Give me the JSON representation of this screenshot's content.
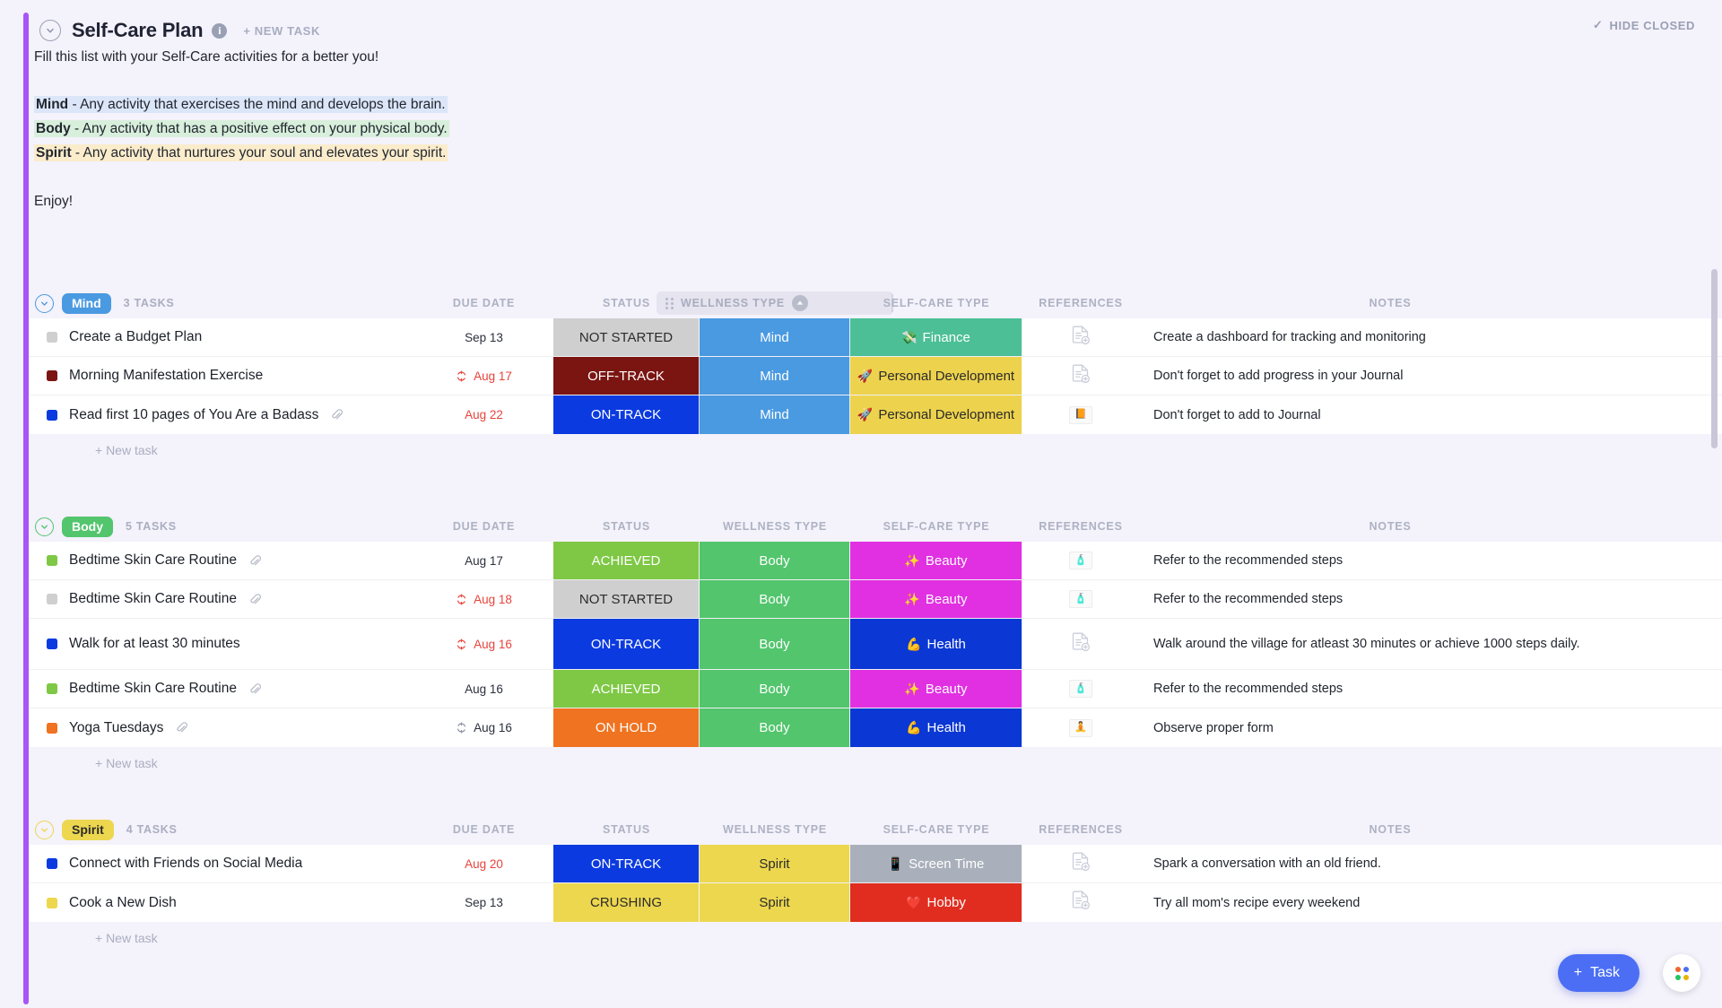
{
  "header": {
    "title": "Self-Care Plan",
    "info_icon": "info-icon",
    "new_task_label": "+ NEW TASK",
    "hide_closed_label": "HIDE CLOSED",
    "check_glyph": "✓"
  },
  "description": {
    "intro": "Fill this list with your Self-Care activities for a better you!",
    "lines": [
      {
        "term": "Mind",
        "text": " - Any activity that exercises the mind and develops the brain.",
        "highlight": "mind"
      },
      {
        "term": "Body",
        "text": " - Any activity that has a positive effect on your physical body.",
        "highlight": "body"
      },
      {
        "term": "Spirit",
        "text": " - Any activity that nurtures your soul and elevates your spirit.",
        "highlight": "spirit"
      }
    ],
    "closing": "Enjoy!"
  },
  "columns": {
    "due_date": "DUE DATE",
    "status": "STATUS",
    "wellness_type": "WELLNESS TYPE",
    "self_care_type": "SELF-CARE TYPE",
    "references": "REFERENCES",
    "notes": "NOTES"
  },
  "new_task_row_label": "+ New task",
  "colors": {
    "accent": "#a855f7",
    "mind": "#4a9ae1",
    "body": "#52c56d",
    "spirit": "#ecd74f",
    "not_started": "#cfcfcf",
    "off_track": "#7a1512",
    "on_track": "#0b3ae0",
    "achieved": "#7ec845",
    "on_hold": "#ef7320",
    "crushing": "#ecd74f",
    "finance": "#4cbf96",
    "personal_development": "#edd24d",
    "beauty": "#e130e1",
    "health": "#0b37d4",
    "screen_time": "#a9b0bb",
    "hobby": "#e02d1f",
    "fab": "#4b6ef5"
  },
  "groups": [
    {
      "name": "Mind",
      "pill_color": "#4a9ae1",
      "count_label": "3 TASKS",
      "tasks": [
        {
          "dot": "#cfcfcf",
          "title": "Create a Budget Plan",
          "attachment": false,
          "date": "Sep 13",
          "recurring": false,
          "overdue": false,
          "status": "NOT STARTED",
          "status_color": "#cfcfcf",
          "status_text_color": "#2b2b2b",
          "wellness": "Mind",
          "wellness_color": "#4a9ae1",
          "wellness_text_color": "#ffffff",
          "self_care_emoji": "💸",
          "self_care": "Finance",
          "self_care_color": "#4cbf96",
          "self_care_text_color": "#ffffff",
          "reference": "doc-plus",
          "notes": "Create a dashboard for tracking and monitoring"
        },
        {
          "dot": "#7a1512",
          "title": "Morning Manifestation Exercise",
          "attachment": false,
          "date": "Aug 17",
          "recurring": true,
          "overdue": true,
          "status": "OFF-TRACK",
          "status_color": "#7a1512",
          "status_text_color": "#ffffff",
          "wellness": "Mind",
          "wellness_color": "#4a9ae1",
          "wellness_text_color": "#ffffff",
          "self_care_emoji": "🚀",
          "self_care": "Personal Development",
          "self_care_color": "#edd24d",
          "self_care_text_color": "#2b2b2b",
          "reference": "doc-plus",
          "notes": "Don't forget to add progress in your Journal"
        },
        {
          "dot": "#0b3ae0",
          "title": "Read first 10 pages of You Are a Badass",
          "attachment": true,
          "date": "Aug 22",
          "recurring": false,
          "overdue": true,
          "status": "ON-TRACK",
          "status_color": "#0b3ae0",
          "status_text_color": "#ffffff",
          "wellness": "Mind",
          "wellness_color": "#4a9ae1",
          "wellness_text_color": "#ffffff",
          "self_care_emoji": "🚀",
          "self_care": "Personal Development",
          "self_care_color": "#edd24d",
          "self_care_text_color": "#2b2b2b",
          "reference": "thumb-book",
          "reference_glyph": "📙",
          "notes": "Don't forget to add to Journal"
        }
      ]
    },
    {
      "name": "Body",
      "pill_color": "#52c56d",
      "count_label": "5 TASKS",
      "tasks": [
        {
          "dot": "#7ec845",
          "title": "Bedtime Skin Care Routine",
          "attachment": true,
          "date": "Aug 17",
          "recurring": false,
          "overdue": false,
          "status": "ACHIEVED",
          "status_color": "#7ec845",
          "status_text_color": "#ffffff",
          "wellness": "Body",
          "wellness_color": "#52c56d",
          "wellness_text_color": "#ffffff",
          "self_care_emoji": "✨",
          "self_care": "Beauty",
          "self_care_color": "#e130e1",
          "self_care_text_color": "#ffffff",
          "reference": "thumb-photo",
          "reference_glyph": "🧴",
          "notes": "Refer to the recommended steps"
        },
        {
          "dot": "#cfcfcf",
          "title": "Bedtime Skin Care Routine",
          "attachment": true,
          "date": "Aug 18",
          "recurring": true,
          "overdue": true,
          "status": "NOT STARTED",
          "status_color": "#cfcfcf",
          "status_text_color": "#2b2b2b",
          "wellness": "Body",
          "wellness_color": "#52c56d",
          "wellness_text_color": "#ffffff",
          "self_care_emoji": "✨",
          "self_care": "Beauty",
          "self_care_color": "#e130e1",
          "self_care_text_color": "#ffffff",
          "reference": "thumb-photo",
          "reference_glyph": "🧴",
          "notes": "Refer to the recommended steps"
        },
        {
          "dot": "#0b3ae0",
          "title": "Walk for at least 30 minutes",
          "attachment": false,
          "date": "Aug 16",
          "recurring": true,
          "overdue": true,
          "status": "ON-TRACK",
          "status_color": "#0b3ae0",
          "status_text_color": "#ffffff",
          "wellness": "Body",
          "wellness_color": "#52c56d",
          "wellness_text_color": "#ffffff",
          "self_care_emoji": "💪",
          "self_care": "Health",
          "self_care_color": "#0b37d4",
          "self_care_text_color": "#ffffff",
          "reference": "doc-plus",
          "notes": "Walk around the village for atleast 30 minutes or achieve 1000 steps daily."
        },
        {
          "dot": "#7ec845",
          "title": "Bedtime Skin Care Routine",
          "attachment": true,
          "date": "Aug 16",
          "recurring": false,
          "overdue": false,
          "status": "ACHIEVED",
          "status_color": "#7ec845",
          "status_text_color": "#ffffff",
          "wellness": "Body",
          "wellness_color": "#52c56d",
          "wellness_text_color": "#ffffff",
          "self_care_emoji": "✨",
          "self_care": "Beauty",
          "self_care_color": "#e130e1",
          "self_care_text_color": "#ffffff",
          "reference": "thumb-photo",
          "reference_glyph": "🧴",
          "notes": "Refer to the recommended steps"
        },
        {
          "dot": "#ef7320",
          "title": "Yoga Tuesdays",
          "attachment": true,
          "date": "Aug 16",
          "recurring": true,
          "overdue": false,
          "status": "ON HOLD",
          "status_color": "#ef7320",
          "status_text_color": "#ffffff",
          "wellness": "Body",
          "wellness_color": "#52c56d",
          "wellness_text_color": "#ffffff",
          "self_care_emoji": "💪",
          "self_care": "Health",
          "self_care_color": "#0b37d4",
          "self_care_text_color": "#ffffff",
          "reference": "thumb-person",
          "reference_glyph": "🧘",
          "notes": "Observe proper form"
        }
      ]
    },
    {
      "name": "Spirit",
      "pill_color": "#ecd74f",
      "pill_text_color": "#2b2b2b",
      "count_label": "4 TASKS",
      "tasks": [
        {
          "dot": "#0b3ae0",
          "title": "Connect with Friends on Social Media",
          "attachment": false,
          "date": "Aug 20",
          "recurring": false,
          "overdue": true,
          "status": "ON-TRACK",
          "status_color": "#0b3ae0",
          "status_text_color": "#ffffff",
          "wellness": "Spirit",
          "wellness_color": "#ecd74f",
          "wellness_text_color": "#2b2b2b",
          "self_care_emoji": "📱",
          "self_care": "Screen Time",
          "self_care_color": "#a9b0bb",
          "self_care_text_color": "#ffffff",
          "reference": "doc-plus",
          "notes": "Spark a conversation with an old friend."
        },
        {
          "dot": "#ecd74f",
          "title": "Cook a New Dish",
          "attachment": false,
          "date": "Sep 13",
          "recurring": false,
          "overdue": false,
          "status": "CRUSHING",
          "status_color": "#ecd74f",
          "status_text_color": "#2b2b2b",
          "wellness": "Spirit",
          "wellness_color": "#ecd74f",
          "wellness_text_color": "#2b2b2b",
          "self_care_emoji": "❤️",
          "self_care": "Hobby",
          "self_care_color": "#e02d1f",
          "self_care_text_color": "#ffffff",
          "reference": "doc-plus",
          "notes": "Try all mom's recipe every weekend"
        }
      ]
    }
  ],
  "fab": {
    "label": "Task",
    "plus": "+"
  }
}
